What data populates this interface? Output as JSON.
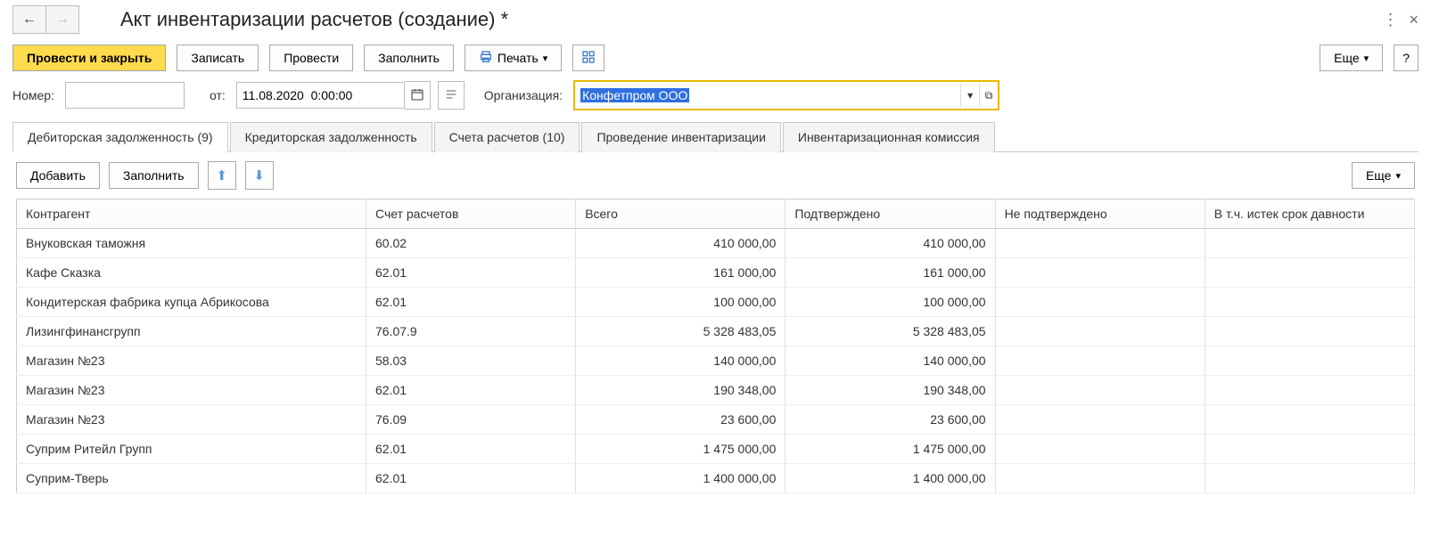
{
  "title": "Акт инвентаризации расчетов (создание) *",
  "toolbar": {
    "post_close": "Провести и закрыть",
    "save": "Записать",
    "post": "Провести",
    "fill": "Заполнить",
    "print": "Печать",
    "more": "Еще",
    "help": "?"
  },
  "form": {
    "number_label": "Номер:",
    "number_value": "",
    "from_label": "от:",
    "date_value": "11.08.2020  0:00:00",
    "org_label": "Организация:",
    "org_value": "Конфетпром ООО"
  },
  "tabs": [
    {
      "label": "Дебиторская задолженность (9)"
    },
    {
      "label": "Кредиторская задолженность"
    },
    {
      "label": "Счета расчетов (10)"
    },
    {
      "label": "Проведение инвентаризации"
    },
    {
      "label": "Инвентаризационная комиссия"
    }
  ],
  "tab_toolbar": {
    "add": "Добавить",
    "fill": "Заполнить",
    "more": "Еще"
  },
  "table": {
    "columns": [
      "Контрагент",
      "Счет расчетов",
      "Всего",
      "Подтверждено",
      "Не подтверждено",
      "В т.ч. истек срок давности"
    ],
    "rows": [
      {
        "c0": "Внуковская таможня",
        "c1": "60.02",
        "c2": "410 000,00",
        "c3": "410 000,00",
        "c4": "",
        "c5": ""
      },
      {
        "c0": "Кафе Сказка",
        "c1": "62.01",
        "c2": "161 000,00",
        "c3": "161 000,00",
        "c4": "",
        "c5": ""
      },
      {
        "c0": "Кондитерская фабрика купца Абрикосова",
        "c1": "62.01",
        "c2": "100 000,00",
        "c3": "100 000,00",
        "c4": "",
        "c5": ""
      },
      {
        "c0": "Лизингфинансгрупп",
        "c1": "76.07.9",
        "c2": "5 328 483,05",
        "c3": "5 328 483,05",
        "c4": "",
        "c5": ""
      },
      {
        "c0": "Магазин №23",
        "c1": "58.03",
        "c2": "140 000,00",
        "c3": "140 000,00",
        "c4": "",
        "c5": ""
      },
      {
        "c0": "Магазин №23",
        "c1": "62.01",
        "c2": "190 348,00",
        "c3": "190 348,00",
        "c4": "",
        "c5": ""
      },
      {
        "c0": "Магазин №23",
        "c1": "76.09",
        "c2": "23 600,00",
        "c3": "23 600,00",
        "c4": "",
        "c5": ""
      },
      {
        "c0": "Суприм Ритейл Групп",
        "c1": "62.01",
        "c2": "1 475 000,00",
        "c3": "1 475 000,00",
        "c4": "",
        "c5": ""
      },
      {
        "c0": "Суприм-Тверь",
        "c1": "62.01",
        "c2": "1 400 000,00",
        "c3": "1 400 000,00",
        "c4": "",
        "c5": ""
      }
    ]
  }
}
